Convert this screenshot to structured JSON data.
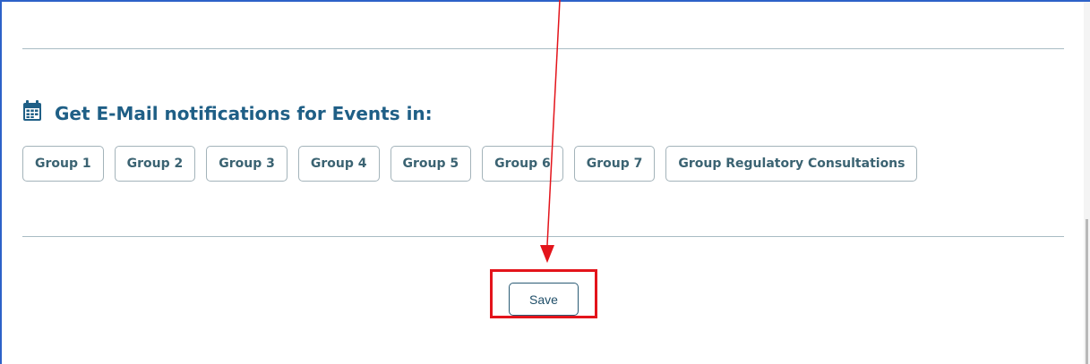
{
  "section": {
    "heading": "Get E-Mail notifications for Events in:",
    "heading_icon": "calendar-icon",
    "heading_color": "#1f5f86"
  },
  "groups": [
    {
      "label": "Group 1"
    },
    {
      "label": "Group 2"
    },
    {
      "label": "Group 3"
    },
    {
      "label": "Group 4"
    },
    {
      "label": "Group 5"
    },
    {
      "label": "Group 6"
    },
    {
      "label": "Group 7"
    },
    {
      "label": "Group Regulatory Consultations"
    }
  ],
  "actions": {
    "save_label": "Save"
  },
  "annotation": {
    "highlight_color": "#e3141b",
    "arrow_color": "#e3141b"
  }
}
